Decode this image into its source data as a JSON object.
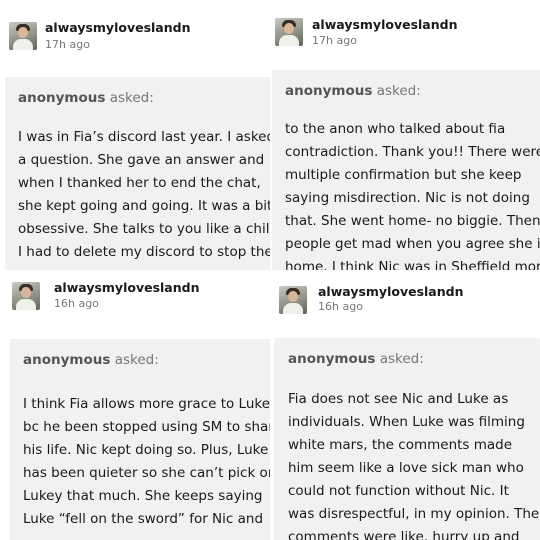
{
  "posts": [
    {
      "username": "alwaysmyloveslandn",
      "time": "17h ago",
      "asker": "anonymous",
      "asked_label": "asked:",
      "lines": [
        "I was in Fia’s discord last year. I asked",
        "a question. She gave an answer and",
        "when I thanked her to end the chat,",
        "she kept going and going. It was a bit",
        "obsessive. She talks to you like a child.",
        "I had to delete my discord to stop the"
      ]
    },
    {
      "username": "alwaysmyloveslandn",
      "time": "17h ago",
      "asker": "anonymous",
      "asked_label": "asked:",
      "lines": [
        "to the anon who talked about fia",
        "contradiction. Thank you!!  There were",
        "multiple confirmation but she keep",
        "saying misdirection. Nic is not doing",
        "that. She went home- no biggie. Then",
        "people get mad when you agree she is",
        "home. I think Nic was in Sheffield more"
      ]
    },
    {
      "username": "alwaysmyloveslandn",
      "time": "16h ago",
      "asker": "anonymous",
      "asked_label": "asked:",
      "lines": [
        "I think Fia allows more grace to Luke",
        "bc he been stopped using SM to share",
        "his life. Nic kept doing so. Plus, Luke",
        "has been quieter so she can’t pick on",
        "Lukey that much. She keeps saying",
        "Luke “fell on the sword” for Nic and"
      ]
    },
    {
      "username": "alwaysmyloveslandn",
      "time": "16h ago",
      "asker": "anonymous",
      "asked_label": "asked:",
      "lines": [
        "Fia does not see Nic and Luke as",
        "individuals. When Luke was filming",
        "white mars, the comments made",
        "him seem like a love sick man who",
        "could not function without Nic. It",
        "was disrespectful, in my opinion. The",
        "comments were like, hurry up and"
      ]
    }
  ]
}
